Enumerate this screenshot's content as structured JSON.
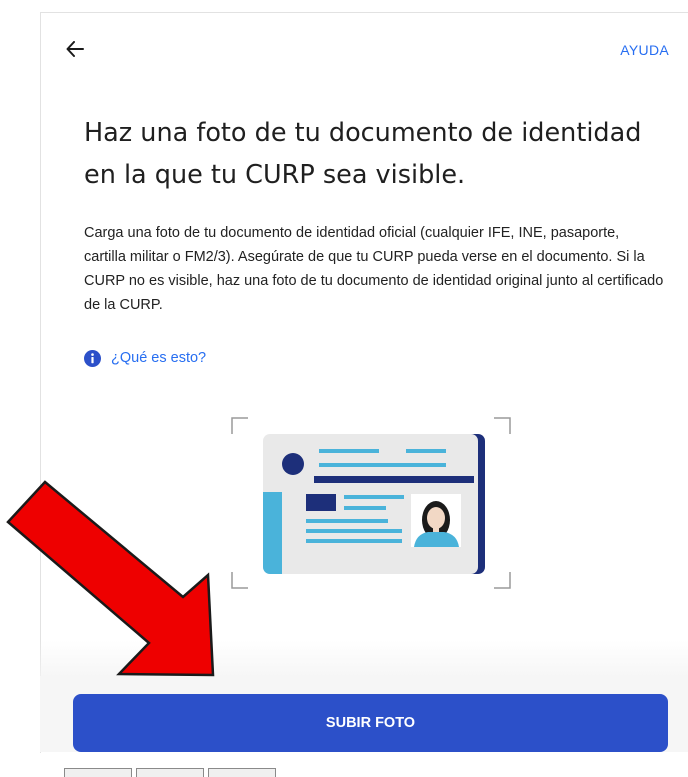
{
  "header": {
    "back_icon": "arrow-left-icon",
    "help_label": "AYUDA"
  },
  "main": {
    "title": "Haz una foto de tu documento de identidad en la que tu CURP sea visible.",
    "description": "Carga una foto de tu documento de identidad oficial (cualquier IFE, INE, pasaporte, cartilla militar o FM2/3). Asegúrate de que tu CURP pueda verse en el documento. Si la CURP no es visible, haz una foto de tu documento de identidad original junto al certificado de la CURP.",
    "info_icon": "info-icon",
    "info_link": "¿Qué es esto?",
    "illustration": "id-card-illustration"
  },
  "footer": {
    "upload_label": "SUBIR FOTO"
  },
  "colors": {
    "accent": "#276ef1",
    "button": "#2c50c9",
    "card_dark": "#1d2f7a",
    "card_light": "#4ab3da",
    "annotation_arrow": "#ee0000"
  }
}
